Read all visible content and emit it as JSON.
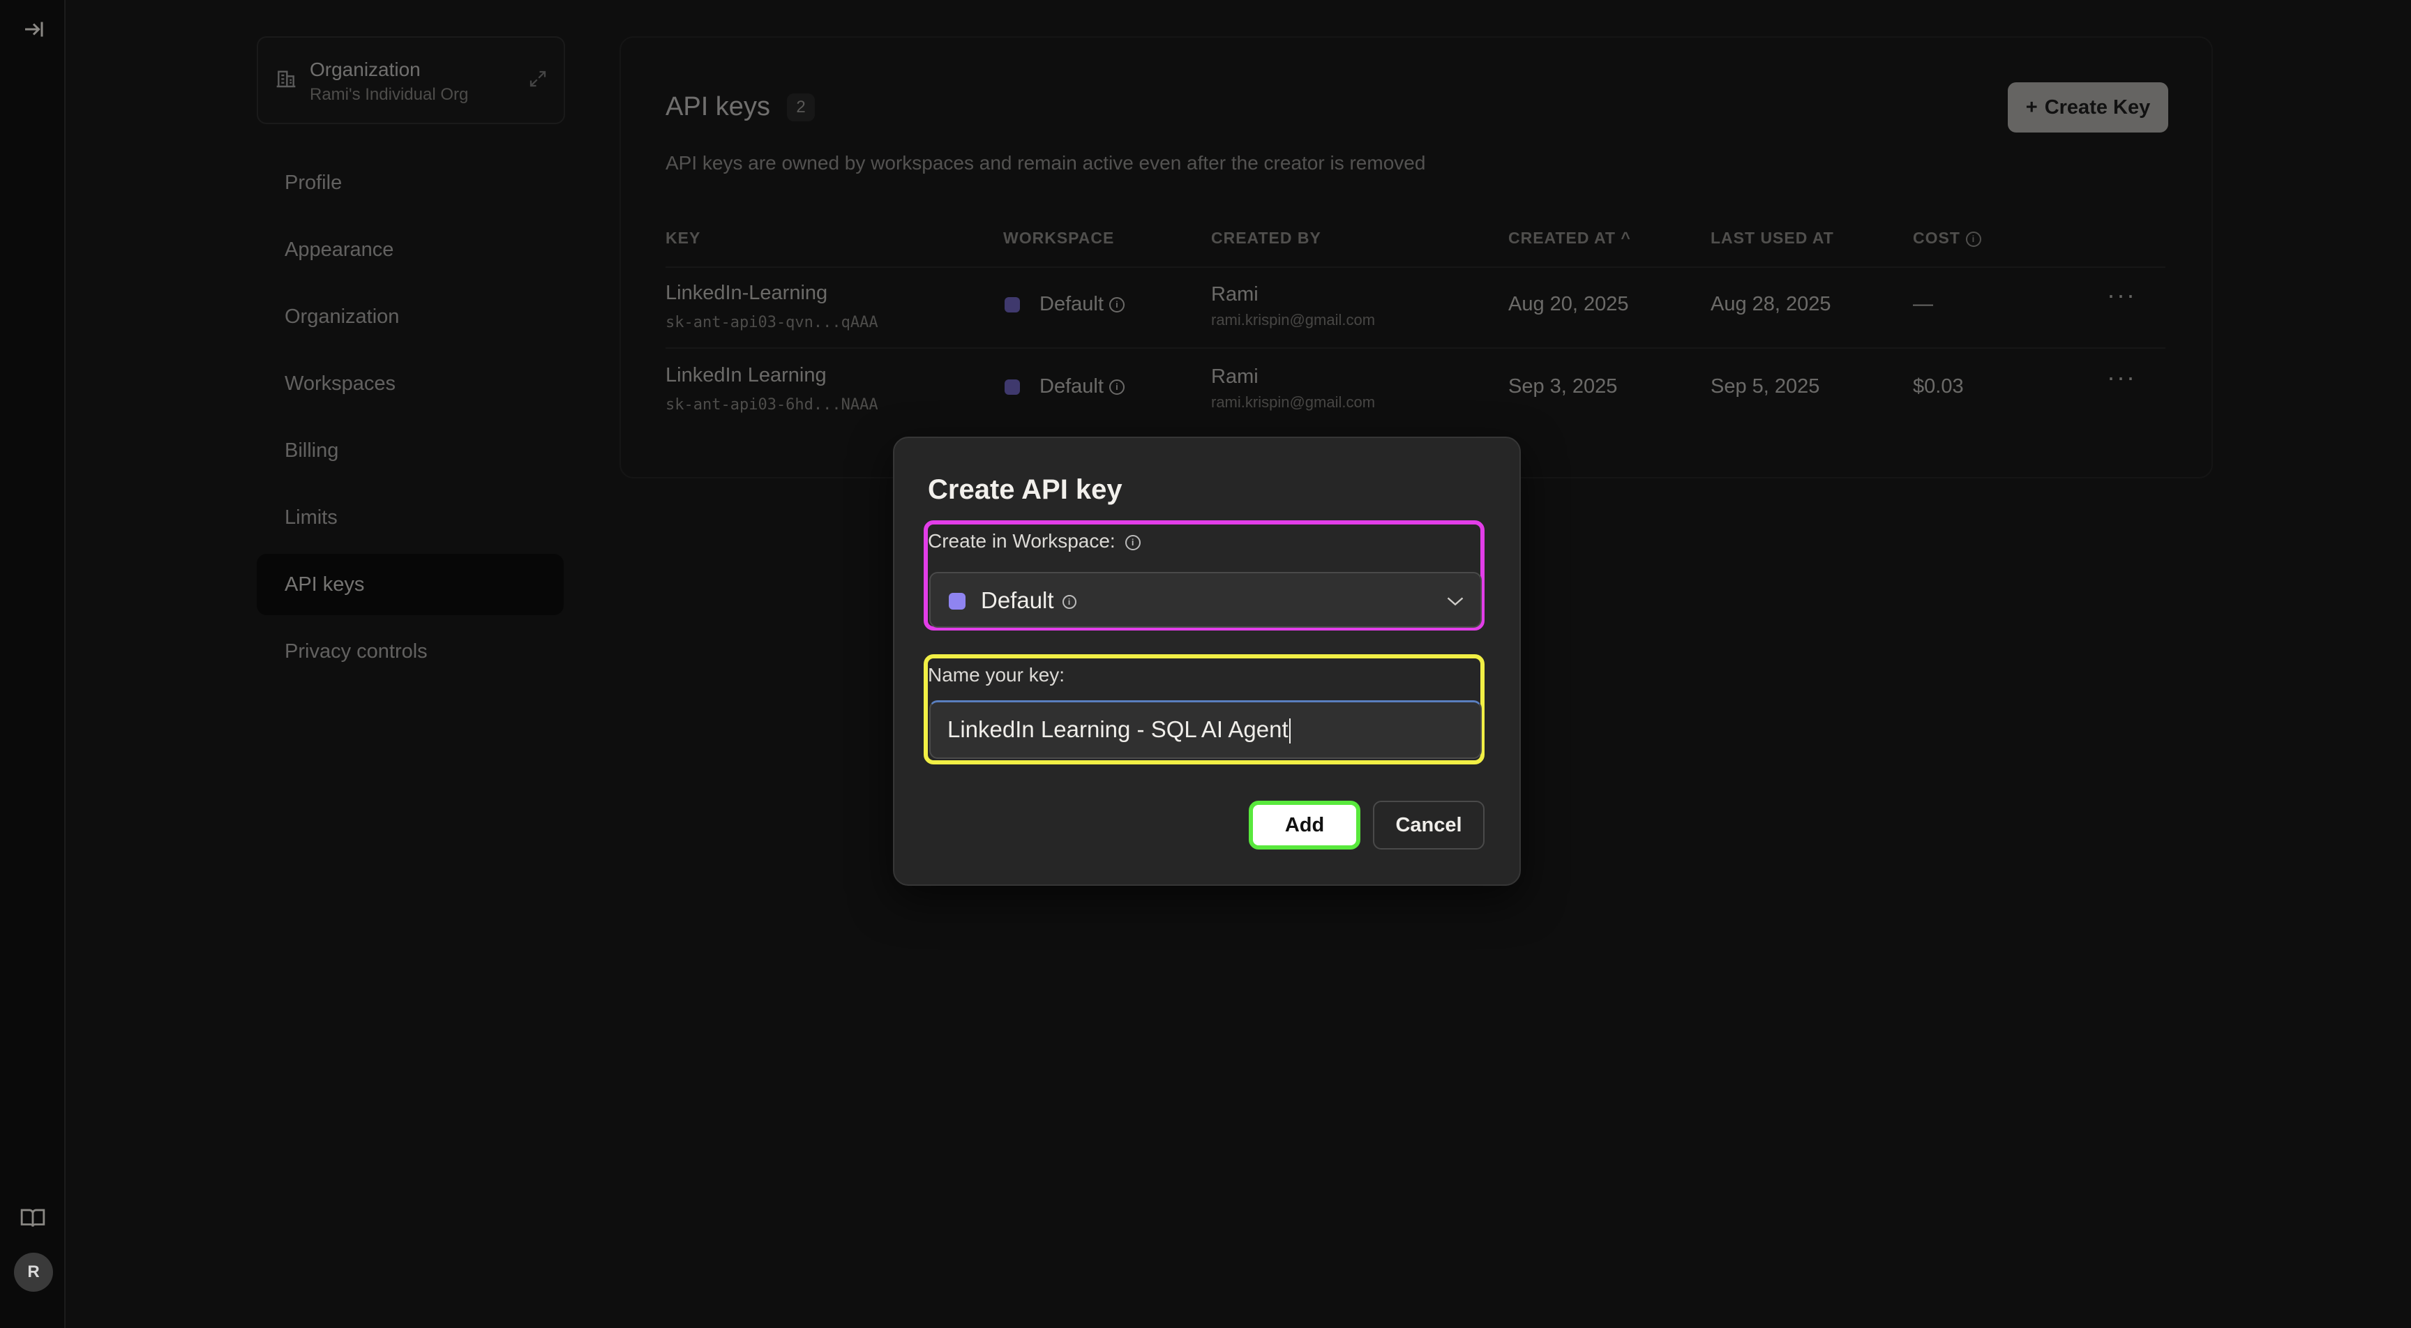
{
  "sidebar": {
    "org_title": "Organization",
    "org_subtitle": "Rami's Individual Org",
    "items": [
      "Profile",
      "Appearance",
      "Organization",
      "Workspaces",
      "Billing",
      "Limits",
      "API keys",
      "Privacy controls"
    ],
    "active": "API keys"
  },
  "rail": {
    "avatar_initial": "R"
  },
  "main": {
    "title": "API keys",
    "count": "2",
    "description": "API keys are owned by workspaces and remain active even after the creator is removed",
    "create_button": "Create Key",
    "columns": [
      "KEY",
      "WORKSPACE",
      "CREATED BY",
      "CREATED AT",
      "LAST USED AT",
      "COST"
    ],
    "rows": [
      {
        "name": "LinkedIn-Learning",
        "key": "sk-ant-api03-qvn...qAAA",
        "workspace": "Default",
        "created_by": "Rami",
        "email": "rami.krispin@gmail.com",
        "created_at": "Aug 20, 2025",
        "last_used": "Aug 28, 2025",
        "cost": "—"
      },
      {
        "name": "LinkedIn Learning",
        "key": "sk-ant-api03-6hd...NAAA",
        "workspace": "Default",
        "created_by": "Rami",
        "email": "rami.krispin@gmail.com",
        "created_at": "Sep 3, 2025",
        "last_used": "Sep 5, 2025",
        "cost": "$0.03"
      }
    ]
  },
  "modal": {
    "title": "Create API key",
    "workspace_label": "Create in Workspace:",
    "workspace_value": "Default",
    "name_label": "Name your key:",
    "name_value": "LinkedIn Learning - SQL AI Agent",
    "add_button": "Add",
    "cancel_button": "Cancel"
  },
  "colors": {
    "highlight_workspace": "#e23de8",
    "highlight_name": "#f1ef45",
    "highlight_add": "#58e83c",
    "workspace_dot": "#8f84f0"
  }
}
